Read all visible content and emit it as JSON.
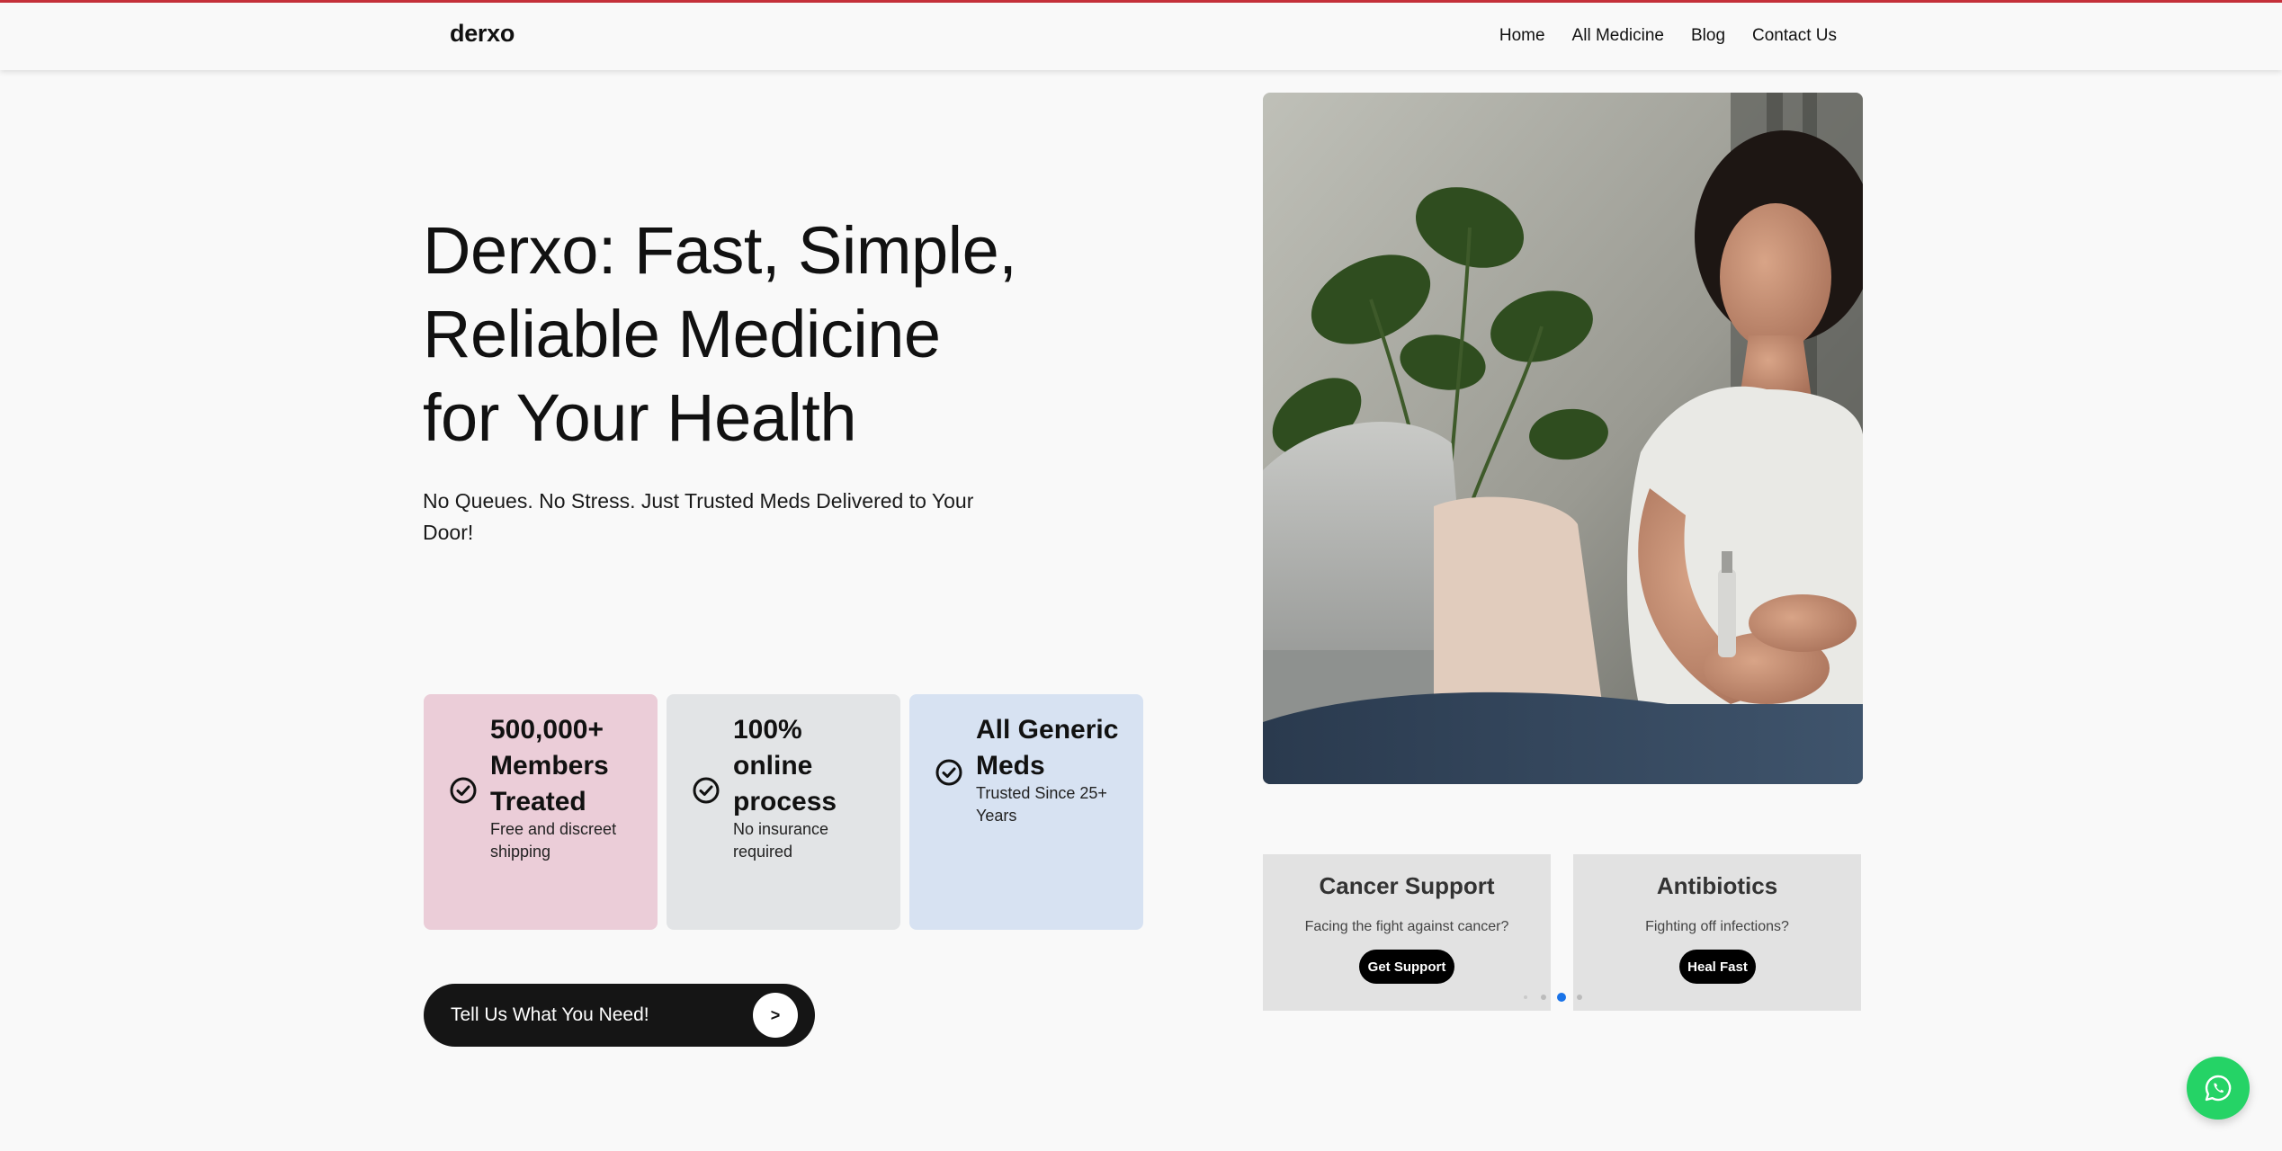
{
  "header": {
    "logo": "derxo",
    "nav": [
      "Home",
      "All Medicine",
      "Blog",
      "Contact Us"
    ]
  },
  "hero": {
    "title_lines": [
      "Derxo: Fast, Simple,",
      "Reliable Medicine",
      "for Your Health"
    ],
    "subtitle": "No Queues. No Stress. Just Trusted Meds Delivered to Your Door!"
  },
  "stats": [
    {
      "title_lines": [
        "500,000+",
        "Members",
        "Treated"
      ],
      "desc": "Free and discreet shipping",
      "color": "#ebcdd8"
    },
    {
      "title_lines": [
        "100%",
        "online",
        "process"
      ],
      "desc": "No insurance required",
      "color": "#e2e4e6"
    },
    {
      "title_lines": [
        "All Generic",
        "Meds"
      ],
      "desc": "Trusted Since 25+ Years",
      "color": "#d7e2f2"
    }
  ],
  "cta": {
    "label": "Tell Us What You Need!",
    "arrow": ">"
  },
  "slides": [
    {
      "title": "Cancer Support",
      "desc": "Facing the fight against cancer?",
      "button": "Get Support"
    },
    {
      "title": "Antibiotics",
      "desc": "Fighting off infections?",
      "button": "Heal Fast"
    }
  ],
  "carousel": {
    "total": 4,
    "active": 3
  },
  "colors": {
    "accent_line": "#c8313b",
    "whatsapp": "#25d366",
    "active_dot": "#1a73e8"
  },
  "icons": {
    "stat": "check-circle-icon",
    "chat": "whatsapp-icon"
  }
}
